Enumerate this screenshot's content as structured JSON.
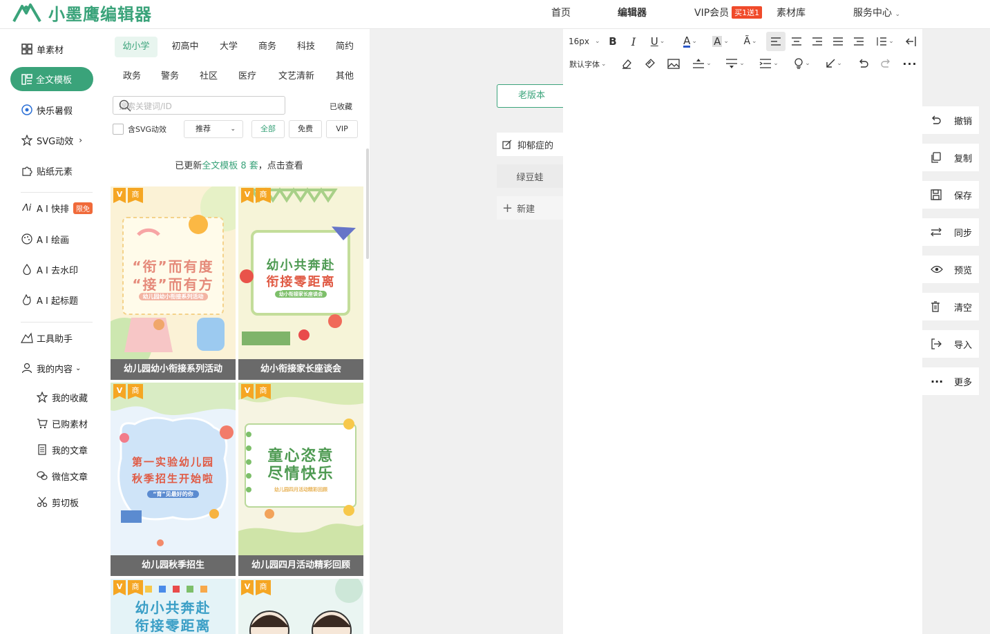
{
  "brand": {
    "name": "小墨鹰编辑器",
    "color": "#3aa37a"
  },
  "topnav": {
    "home": "首页",
    "editor": "编辑器",
    "vip": "VIP会员",
    "vip_promo": "买1送1",
    "materials": "素材库",
    "service": "服务中心"
  },
  "sidebar": {
    "items": [
      {
        "label": "单素材",
        "icon": "grid-icon"
      },
      {
        "label": "全文模板",
        "icon": "template-icon"
      },
      {
        "label": "快乐暑假",
        "icon": "ball-icon"
      },
      {
        "label": "SVG动效",
        "icon": "star-icon"
      },
      {
        "label": "贴纸元素",
        "icon": "puzzle-icon"
      },
      {
        "label": "A I 快排",
        "icon": "ai-icon",
        "badge": "限免"
      },
      {
        "label": "A I 绘画",
        "icon": "palette-icon"
      },
      {
        "label": "A I 去水印",
        "icon": "drop-icon"
      },
      {
        "label": "A I 起标题",
        "icon": "hand-icon"
      },
      {
        "label": "工具助手",
        "icon": "tools-icon"
      },
      {
        "label": "我的内容",
        "icon": "user-icon"
      },
      {
        "label": "我的收藏",
        "icon": "star-icon"
      },
      {
        "label": "已购素材",
        "icon": "cart-icon"
      },
      {
        "label": "我的文章",
        "icon": "doc-icon"
      },
      {
        "label": "微信文章",
        "icon": "wechat-icon"
      },
      {
        "label": "剪切板",
        "icon": "scissors-icon"
      }
    ]
  },
  "panel": {
    "categories_row1": [
      "幼小学",
      "初高中",
      "大学",
      "商务",
      "科技",
      "简约"
    ],
    "categories_row2": [
      "政务",
      "警务",
      "社区",
      "医疗",
      "文艺清新",
      "其他"
    ],
    "search_placeholder": "搜索关键词/ID",
    "favorites": "已收藏",
    "svg_checkbox": "含SVG动效",
    "sort": "推荐",
    "filters": [
      "全部",
      "免费",
      "VIP"
    ],
    "notice_prefix": "已更新",
    "notice_link": "全文模板 8 套",
    "notice_suffix": "，点击查看",
    "tag_v": "V",
    "tag_shang": "商",
    "cards": [
      {
        "caption": "幼儿园幼小衔接系列活动",
        "title1": "“衔”而有度",
        "title2": "“接”而有方",
        "sub": "幼儿园幼小衔接系列活动"
      },
      {
        "caption": "幼小衔接家长座谈会",
        "title1": "幼小共奔赴",
        "title2": "衔接零距离",
        "sub": "幼小衔接家长座谈会"
      },
      {
        "caption": "幼儿园秋季招生",
        "title1": "第一实验幼儿园",
        "title2": "秋季招生开始啦",
        "sub": "“育”见最好的你"
      },
      {
        "caption": "幼儿园四月活动精彩回顾",
        "title1": "童心恣意",
        "title2": "尽情快乐",
        "sub": "幼儿园四月活动精彩回顾"
      },
      {
        "title1": "幼小共奔赴",
        "title2": "衔接零距离"
      },
      {
        "title1": "",
        "title2": ""
      }
    ]
  },
  "docs": {
    "old_version": "老版本",
    "items": [
      "抑郁症的",
      "绿豆蛙"
    ],
    "new": "新建"
  },
  "toolbar": {
    "font_size": "16px",
    "font_family": "默认字体"
  },
  "right_actions": [
    "撤销",
    "复制",
    "保存",
    "同步",
    "预览",
    "清空",
    "导入",
    "更多"
  ]
}
